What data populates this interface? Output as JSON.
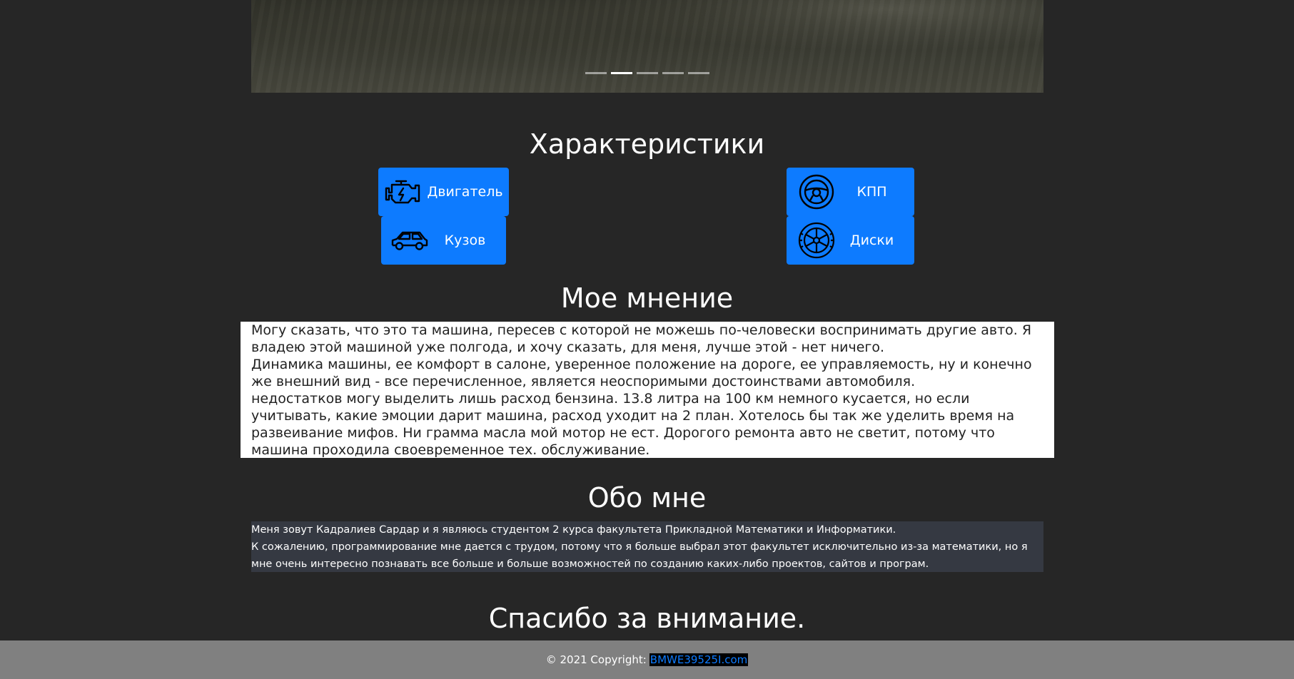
{
  "carousel": {
    "indicator_count": 5,
    "active_index": 1
  },
  "specs": {
    "title": "Характеристики",
    "buttons": [
      {
        "label": "Двигатель",
        "icon": "engine-icon"
      },
      {
        "label": "Кузов",
        "icon": "car-icon"
      },
      {
        "label": "КПП",
        "icon": "steering-wheel-icon"
      },
      {
        "label": "Диски",
        "icon": "wheel-icon"
      }
    ],
    "button_color": "#0d7bff"
  },
  "opinion": {
    "title": "Мое мнение",
    "paragraphs": [
      "Могу сказать, что это та машина, пересев с которой не можешь по-человески воспринимать другие авто. Я владею этой машиной уже полгода, и хочу сказать, для меня, лучше этой - нет ничего.",
      "Динамика машины, ее комфорт в салоне, уверенное положение на дороге, ее управляемость, ну и конечно же внешний вид - все перечисленное, является неоспоримыми достоинствами автомобиля.",
      "недостатков могу выделить лишь расход бензина. 13.8 литра на 100 км немного кусается, но если учитывать, какие эмоции дарит машина, расход уходит на 2 план. Хотелось бы так же уделить время на развеивание мифов. Ни грамма масла мой мотор не ест. Дорогого ремонта авто не светит, потому что машина проходила своевременное тех. обслуживание."
    ]
  },
  "about": {
    "title": "Обо мне",
    "paragraphs": [
      "Меня зовут Кадралиев Сардар и я являюсь студентом 2 курса факультета Прикладной Математики и Информатики.",
      "К сожалению, программирование мне дается с трудом, потому что я больше выбрал этот факультет исключительно из-за математики, но я мне очень интересно познавать все больше и больше возможностей по созданию каких-либо проектов, сайтов и програм."
    ]
  },
  "thanks": {
    "title": "Спасибо за внимание."
  },
  "footer": {
    "copyright": "© 2021 Copyright:",
    "link_text": "BMWE39525I.com"
  },
  "colors": {
    "background": "#262626",
    "accent": "#0d7bff",
    "about_bg": "#353942",
    "footer_bg": "#808080"
  }
}
